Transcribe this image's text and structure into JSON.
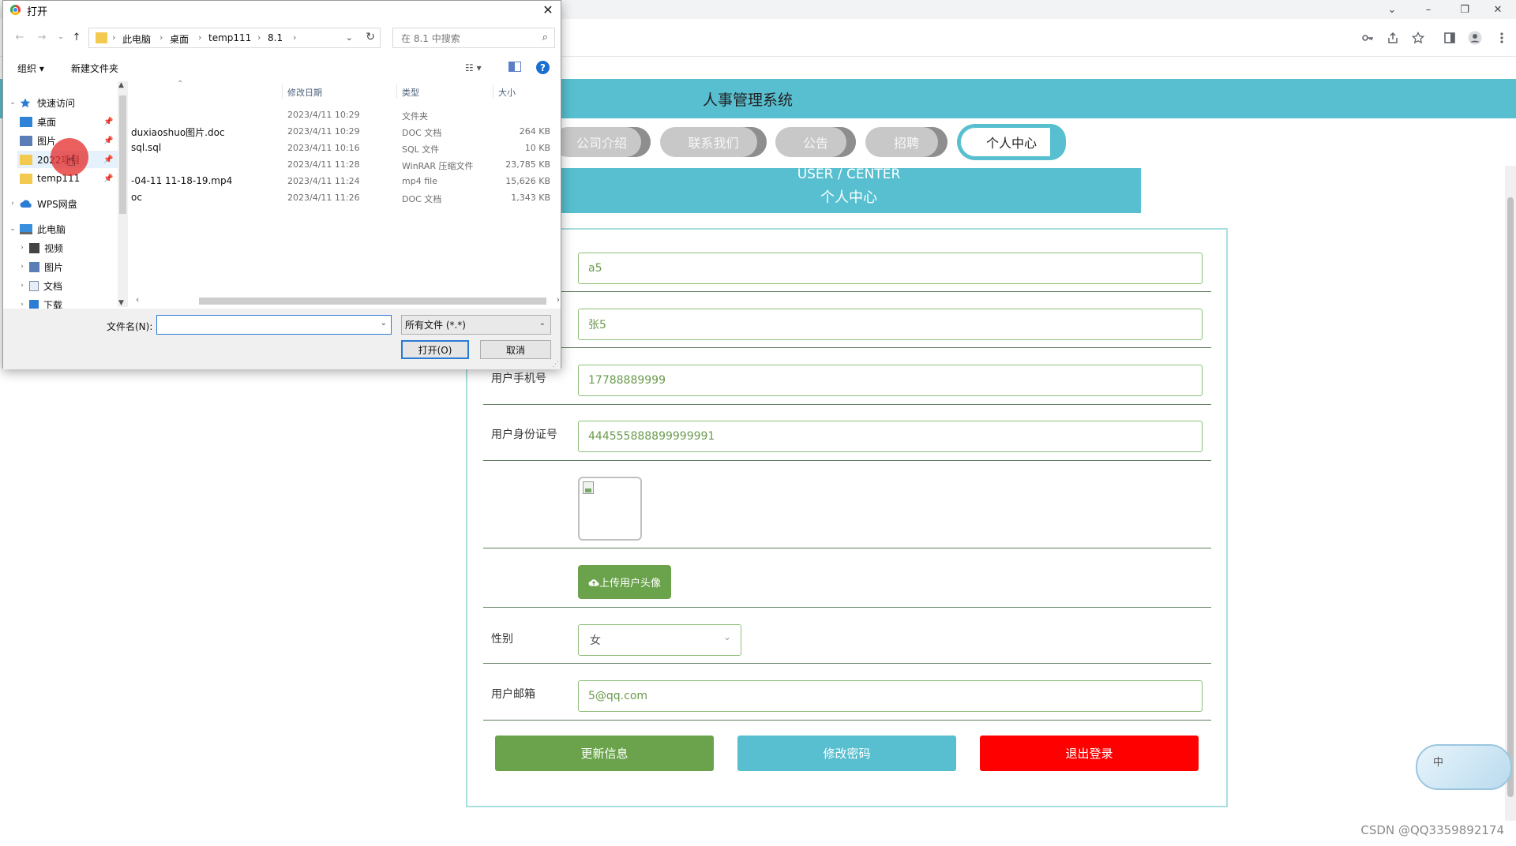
{
  "browser": {
    "window_controls": [
      "⌄",
      "–",
      "❐",
      "✕"
    ],
    "toolbar_icons": [
      "key-icon",
      "share-icon",
      "star-icon",
      "sidebar-icon",
      "profile-icon",
      "menu-icon"
    ]
  },
  "site": {
    "title": "人事管理系统",
    "nav_tabs": [
      {
        "label": "公司介绍",
        "active": false
      },
      {
        "label": "联系我们",
        "active": false
      },
      {
        "label": "公告",
        "active": false
      },
      {
        "label": "招聘",
        "active": false
      },
      {
        "label": "个人中心",
        "active": true
      }
    ],
    "banner_en": "USER / CENTER",
    "banner_cn": "个人中心"
  },
  "form": {
    "username_value": "a5",
    "name_value": "张5",
    "phone_label": "用户手机号",
    "phone_value": "17788889999",
    "idcard_label": "用户身份证号",
    "idcard_value": "444555888899999991",
    "upload_button": "上传用户头像",
    "gender_label": "性别",
    "gender_value": "女",
    "email_label": "用户邮箱",
    "email_value": "5@qq.com"
  },
  "actions": {
    "update": "更新信息",
    "change_password": "修改密码",
    "logout": "退出登录"
  },
  "colors": {
    "header": "#57bfcf",
    "update_button": "#6aa34b",
    "password_button": "#57bfcf",
    "logout_button": "#ff0000"
  },
  "ime": {
    "label": "中"
  },
  "watermark": "CSDN @QQ3359892174",
  "dialog": {
    "title": "打开",
    "breadcrumbs": [
      "此电脑",
      "桌面",
      "temp111",
      "8.1"
    ],
    "search_placeholder": "在 8.1 中搜索",
    "organize": "组织 ▾",
    "new_folder": "新建文件夹",
    "help": "?",
    "nav_items": [
      {
        "label": "快速访问",
        "icon": "star-icon",
        "level": 0,
        "expanded": true
      },
      {
        "label": "桌面",
        "icon": "desktop-icon",
        "level": 1,
        "pinned": true
      },
      {
        "label": "图片",
        "icon": "pictures-icon",
        "level": 1,
        "pinned": true
      },
      {
        "label": "2022项目",
        "icon": "folder-icon",
        "level": 1,
        "pinned": true,
        "selected": true
      },
      {
        "label": "temp111",
        "icon": "folder-icon",
        "level": 1,
        "pinned": true
      },
      {
        "label": "WPS网盘",
        "icon": "cloud-icon",
        "level": 0
      },
      {
        "label": "此电脑",
        "icon": "computer-icon",
        "level": 0,
        "expanded": true
      },
      {
        "label": "视频",
        "icon": "video-icon",
        "level": 1
      },
      {
        "label": "图片",
        "icon": "pictures-icon",
        "level": 1
      },
      {
        "label": "文档",
        "icon": "documents-icon",
        "level": 1
      },
      {
        "label": "下载",
        "icon": "download-icon",
        "level": 1
      }
    ],
    "columns": {
      "name": "",
      "date": "修改日期",
      "type": "类型",
      "size": "大小"
    },
    "files": [
      {
        "name": "",
        "date": "2023/4/11 10:29",
        "type": "文件夹",
        "size": ""
      },
      {
        "name": "duxiaoshuo图片.doc",
        "date": "2023/4/11 10:29",
        "type": "DOC 文档",
        "size": "264 KB"
      },
      {
        "name": "sql.sql",
        "date": "2023/4/11 10:16",
        "type": "SQL 文件",
        "size": "10 KB"
      },
      {
        "name": "",
        "date": "2023/4/11 11:28",
        "type": "WinRAR 压缩文件",
        "size": "23,785 KB"
      },
      {
        "name": "-04-11 11-18-19.mp4",
        "date": "2023/4/11 11:24",
        "type": "mp4 file",
        "size": "15,626 KB"
      },
      {
        "name": "oc",
        "date": "2023/4/11 11:26",
        "type": "DOC 文档",
        "size": "1,343 KB"
      }
    ],
    "filename_label": "文件名(N):",
    "filename_value": "",
    "filetype": "所有文件 (*.*)",
    "open_button": "打开(O)",
    "cancel_button": "取消"
  }
}
